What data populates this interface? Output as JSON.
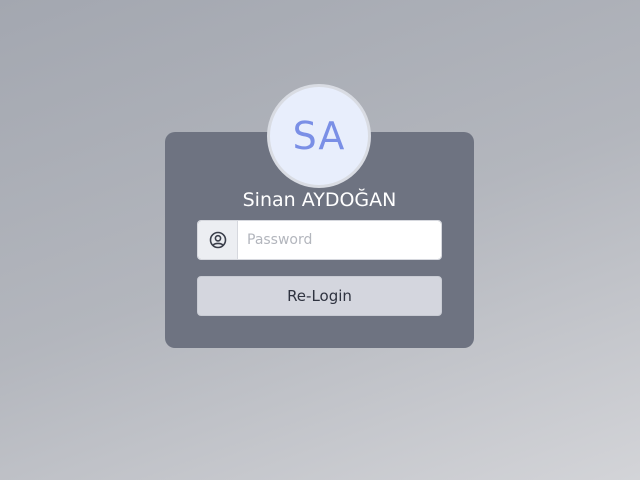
{
  "user": {
    "initials": "SA",
    "name": "Sinan AYDOĞAN"
  },
  "password_field": {
    "placeholder": "Password",
    "value": "",
    "icon": "user-circle-icon"
  },
  "relogin_button": {
    "label": "Re-Login"
  },
  "colors": {
    "card": "#6e7381",
    "avatar_bg": "#e8eefc",
    "avatar_text": "#7a8fe6",
    "button_bg": "#d4d6de"
  }
}
